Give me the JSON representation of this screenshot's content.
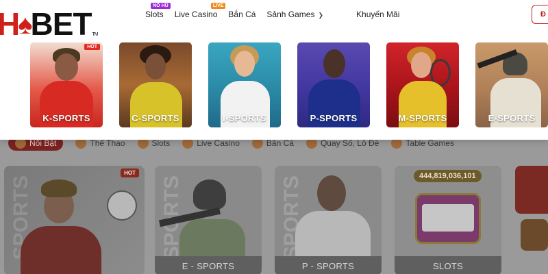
{
  "brand": {
    "logo_text": "HDBET"
  },
  "header": {
    "nav": [
      {
        "label": "Slots",
        "badge": "NỔ HŨ"
      },
      {
        "label": "Live Casino",
        "badge": "LIVE"
      },
      {
        "label": "Bắn Cá"
      },
      {
        "label": "Sảnh Games"
      },
      {
        "label": "Khuyến Mãi"
      }
    ],
    "right_button_label": "Đ"
  },
  "dropdown": {
    "hot_badge": "HOT",
    "items": [
      {
        "label": "K-SPORTS",
        "hot": true
      },
      {
        "label": "C-SPORTS"
      },
      {
        "label": "I-SPORTS"
      },
      {
        "label": "P-SPORTS"
      },
      {
        "label": "M-SPORTS"
      },
      {
        "label": "E-SPORTS"
      }
    ]
  },
  "background": {
    "categories": [
      "Nổi Bật",
      "Thể Thao",
      "Slots",
      "Live Casino",
      "Bắn Cá",
      "Quay Số, Lô Đề",
      "Table Games"
    ],
    "cards": [
      {
        "caption": "",
        "hot": "HOT"
      },
      {
        "caption": "E - SPORTS",
        "watermark": "SPORTS"
      },
      {
        "caption": "P - SPORTS",
        "watermark": "SPORTS"
      },
      {
        "caption": "SLOTS",
        "jackpot": "444,819,036,101"
      }
    ]
  },
  "colors": {
    "brand_red": "#d0201b",
    "hot_badge": "#e8291f",
    "new_badge": "#9b2bd8",
    "live_badge": "#f08a1c"
  }
}
